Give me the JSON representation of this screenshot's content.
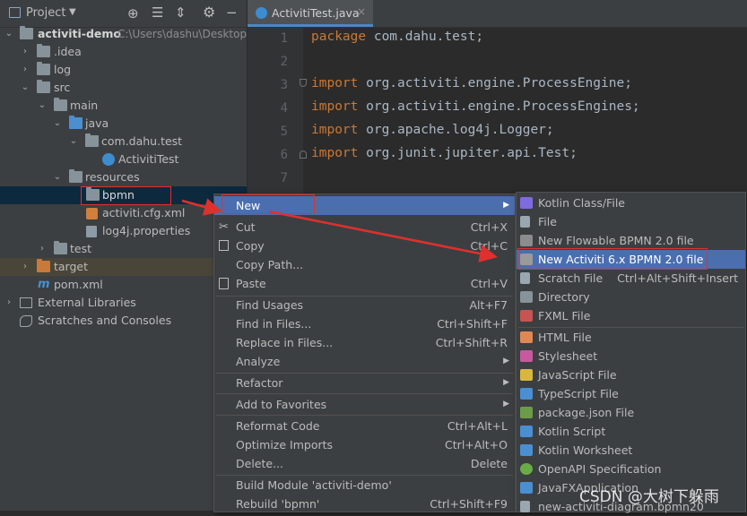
{
  "project_panel": {
    "title": "Project",
    "tree": [
      {
        "label": "activiti-demo",
        "path": "C:\\Users\\dashu\\Desktop",
        "bold": true
      },
      {
        "label": ".idea"
      },
      {
        "label": "log"
      },
      {
        "label": "src"
      },
      {
        "label": "main"
      },
      {
        "label": "java"
      },
      {
        "label": "com.dahu.test"
      },
      {
        "label": "ActivitiTest"
      },
      {
        "label": "resources"
      },
      {
        "label": "bpmn"
      },
      {
        "label": "activiti.cfg.xml"
      },
      {
        "label": "log4j.properties"
      },
      {
        "label": "test"
      },
      {
        "label": "target"
      },
      {
        "label": "pom.xml"
      },
      {
        "label": "External Libraries"
      },
      {
        "label": "Scratches and Consoles"
      }
    ]
  },
  "editor": {
    "tab_label": "ActivitiTest.java",
    "lines": [
      {
        "num": "1",
        "kw": "package",
        "rest": " com.dahu.test;"
      },
      {
        "num": "2",
        "kw": "",
        "rest": ""
      },
      {
        "num": "3",
        "kw": "import",
        "rest": " org.activiti.engine.ProcessEngine;"
      },
      {
        "num": "4",
        "kw": "import",
        "rest": " org.activiti.engine.ProcessEngines;"
      },
      {
        "num": "5",
        "kw": "import",
        "rest": " org.apache.log4j.Logger;"
      },
      {
        "num": "6",
        "kw": "import",
        "rest": " org.junit.jupiter.api.Test;"
      },
      {
        "num": "7",
        "kw": "",
        "rest": ""
      }
    ]
  },
  "context_menu": {
    "items": [
      {
        "label": "New",
        "shortcut": "",
        "submenu": true,
        "selected": true
      },
      {
        "label": "Cut",
        "shortcut": "Ctrl+X"
      },
      {
        "label": "Copy",
        "shortcut": "Ctrl+C"
      },
      {
        "label": "Copy Path...",
        "shortcut": ""
      },
      {
        "label": "Paste",
        "shortcut": "Ctrl+V"
      },
      {
        "label": "Find Usages",
        "shortcut": "Alt+F7"
      },
      {
        "label": "Find in Files...",
        "shortcut": "Ctrl+Shift+F"
      },
      {
        "label": "Replace in Files...",
        "shortcut": "Ctrl+Shift+R"
      },
      {
        "label": "Analyze",
        "shortcut": "",
        "submenu": true
      },
      {
        "label": "Refactor",
        "shortcut": "",
        "submenu": true
      },
      {
        "label": "Add to Favorites",
        "shortcut": "",
        "submenu": true
      },
      {
        "label": "Reformat Code",
        "shortcut": "Ctrl+Alt+L"
      },
      {
        "label": "Optimize Imports",
        "shortcut": "Ctrl+Alt+O"
      },
      {
        "label": "Delete...",
        "shortcut": "Delete"
      },
      {
        "label": "Build Module 'activiti-demo'",
        "shortcut": ""
      },
      {
        "label": "Rebuild 'bpmn'",
        "shortcut": "Ctrl+Shift+F9"
      }
    ]
  },
  "new_submenu": {
    "items": [
      {
        "label": "Kotlin Class/File",
        "shortcut": "",
        "icon": "kotlin-icon",
        "color": "#7f6be0"
      },
      {
        "label": "File",
        "shortcut": "",
        "icon": "file-icon",
        "color": "#9aa7b0"
      },
      {
        "label": "New Flowable BPMN 2.0 file",
        "shortcut": "",
        "icon": "flowable-icon",
        "color": "#8c8c8c"
      },
      {
        "label": "New Activiti 6.x BPMN 2.0 file",
        "shortcut": "",
        "icon": "activiti-icon",
        "color": "#8c8c8c",
        "selected": true
      },
      {
        "label": "Scratch File",
        "shortcut": "Ctrl+Alt+Shift+Insert",
        "icon": "scratch-file-icon",
        "color": "#9aa7b0"
      },
      {
        "label": "Directory",
        "shortcut": "",
        "icon": "directory-icon",
        "color": "#87939a"
      },
      {
        "label": "FXML File",
        "shortcut": "",
        "icon": "fxml-icon",
        "color": "#c75450"
      },
      {
        "label": "HTML File",
        "shortcut": "",
        "icon": "html-icon",
        "color": "#e08855"
      },
      {
        "label": "Stylesheet",
        "shortcut": "",
        "icon": "css-icon",
        "color": "#c75a9f"
      },
      {
        "label": "JavaScript File",
        "shortcut": "",
        "icon": "javascript-icon",
        "color": "#d8b640"
      },
      {
        "label": "TypeScript File",
        "shortcut": "",
        "icon": "typescript-icon",
        "color": "#4a8fd1"
      },
      {
        "label": "package.json File",
        "shortcut": "",
        "icon": "package-json-icon",
        "color": "#6c9c4a"
      },
      {
        "label": "Kotlin Script",
        "shortcut": "",
        "icon": "kotlin-script-icon",
        "color": "#4a8fd1"
      },
      {
        "label": "Kotlin Worksheet",
        "shortcut": "",
        "icon": "kotlin-worksheet-icon",
        "color": "#4a8fd1"
      },
      {
        "label": "OpenAPI Specification",
        "shortcut": "",
        "icon": "openapi-icon",
        "color": "#6aab48"
      },
      {
        "label": "JavaFXApplication",
        "shortcut": "",
        "icon": "javafx-icon",
        "color": "#4a8fd1"
      },
      {
        "label": "new-activiti-diagram.bpmn20",
        "shortcut": "",
        "icon": "bpmn-file-icon",
        "color": "#9aa7b0"
      }
    ]
  },
  "watermark": "CSDN @大树下躲雨",
  "colors": {
    "accent": "#4b6eaf",
    "highlight_box": "#e0302e",
    "keyword": "#cc7832"
  }
}
